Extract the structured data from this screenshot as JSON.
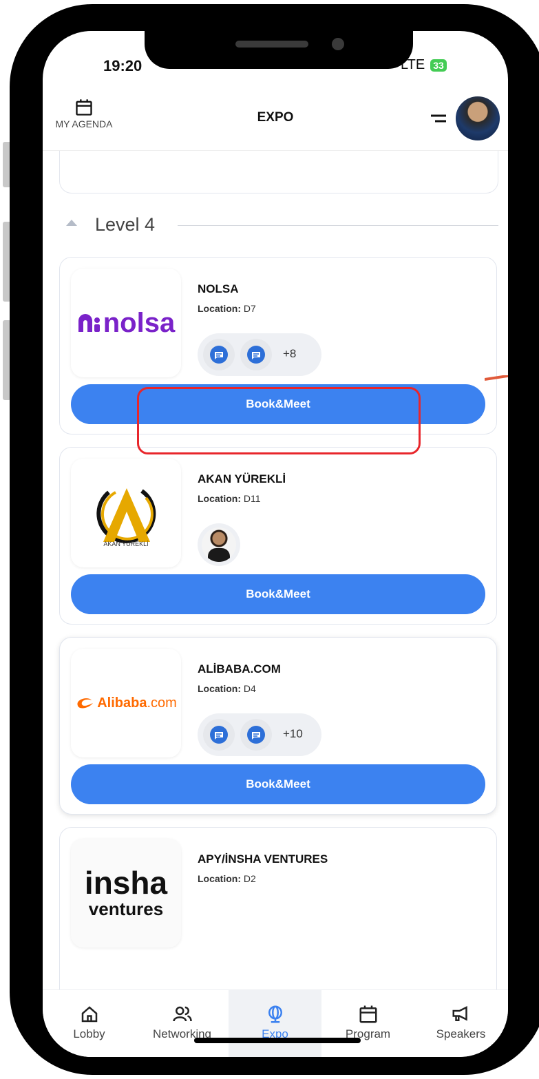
{
  "status_bar": {
    "time": "19:20",
    "network": "LTE",
    "battery": "33"
  },
  "header": {
    "agenda_label": "MY AGENDA",
    "title": "EXPO"
  },
  "section": {
    "label": "Level 4"
  },
  "exhibitors": [
    {
      "name": "NOLSA",
      "location_label": "Location:",
      "location": "D7",
      "logo_text": "nolsa",
      "extra_count": "+8",
      "button": "Book&Meet"
    },
    {
      "name": "AKAN YÜREKLİ",
      "location_label": "Location:",
      "location": "D11",
      "logo_text": "AKAN YÜREKLİ",
      "button": "Book&Meet"
    },
    {
      "name": "ALİBABA.COM",
      "location_label": "Location:",
      "location": "D4",
      "logo_text": "Alibaba",
      "logo_suffix": ".com",
      "extra_count": "+10",
      "button": "Book&Meet"
    },
    {
      "name": "APY/İNSHA VENTURES",
      "location_label": "Location:",
      "location": "D2",
      "logo_text": "insha",
      "logo_sub": "ventures"
    }
  ],
  "tabs": [
    {
      "label": "Lobby",
      "icon": "home-icon"
    },
    {
      "label": "Networking",
      "icon": "people-icon"
    },
    {
      "label": "Expo",
      "icon": "globe-icon",
      "active": true
    },
    {
      "label": "Program",
      "icon": "calendar-icon"
    },
    {
      "label": "Speakers",
      "icon": "megaphone-icon"
    }
  ],
  "colors": {
    "accent": "#3c82f0",
    "highlight": "#e8262b",
    "nolsa_purple": "#7a22c9",
    "alibaba_orange": "#ff6a00"
  }
}
